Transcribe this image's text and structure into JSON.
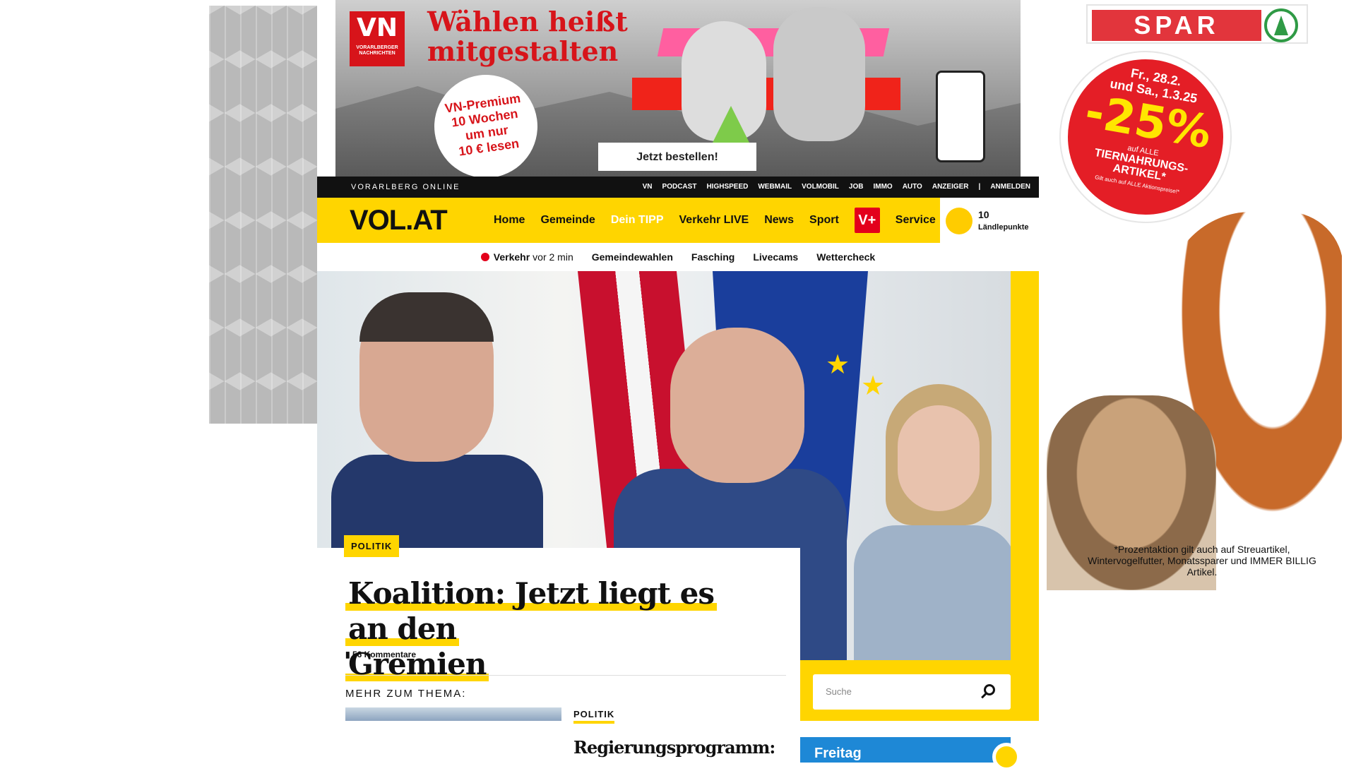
{
  "top_banner": {
    "logo_text": "VN",
    "logo_subtext": "VORARLBERGER NACHRICHTEN",
    "headline_line1": "Wählen heißt",
    "headline_line2": "mitgestalten",
    "offer_line1": "VN-Premium",
    "offer_line2": "10 Wochen",
    "offer_line3": "um nur",
    "offer_line4": "10 € lesen",
    "cta": "Jetzt bestellen!"
  },
  "topbar": {
    "brand": "VORARLBERG ONLINE",
    "links": [
      "VN",
      "PODCAST",
      "HIGHSPEED",
      "WEBMAIL",
      "VOLMOBIL",
      "JOB",
      "IMMO",
      "AUTO",
      "ANZEIGER",
      "|",
      "ANMELDEN"
    ]
  },
  "nav": {
    "logo": "VOL.AT",
    "items": [
      "Home",
      "Gemeinde",
      "Dein TIPP",
      "Verkehr LIVE",
      "News",
      "Sport"
    ],
    "vplus": "V+",
    "service": "Service",
    "points_value": "10",
    "points_label": "Ländlepunkte"
  },
  "subnav": {
    "verkehr": "Verkehr",
    "verkehr_time": "vor 2 min",
    "items": [
      "Gemeindewahlen",
      "Fasching",
      "Livecams",
      "Wettercheck"
    ]
  },
  "hero": {
    "category": "POLITIK",
    "headline_line1": "Koalition: Jetzt liegt es an den",
    "headline_line2": "Gremien",
    "comments": "56 Kommentare",
    "mehr": "MEHR ZUM THEMA:",
    "related_category": "POLITIK",
    "related_title": "Regierungsprogramm:"
  },
  "search": {
    "placeholder": "Suche"
  },
  "weather": {
    "day": "Freitag"
  },
  "spar_ad": {
    "logo": "SPAR",
    "date_line1": "Fr., 28.2.",
    "date_line2": "und Sa., 1.3.25",
    "percent": "-25%",
    "auf_alle": "auf ALLE",
    "article_line1": "TIERNAHRUNGS-",
    "article_line2": "ARTIKEL*",
    "note": "Gilt auch auf ALLE Aktionspreise!*",
    "footnote": "*Prozentaktion gilt auch auf Streuartikel, Wintervogelfutter, Monatssparer und IMMER BILLIG Artikel."
  },
  "colors": {
    "brand_yellow": "#ffd500",
    "vn_red": "#d7141a",
    "spar_red": "#e2353c",
    "spar_green": "#2f9a45"
  }
}
